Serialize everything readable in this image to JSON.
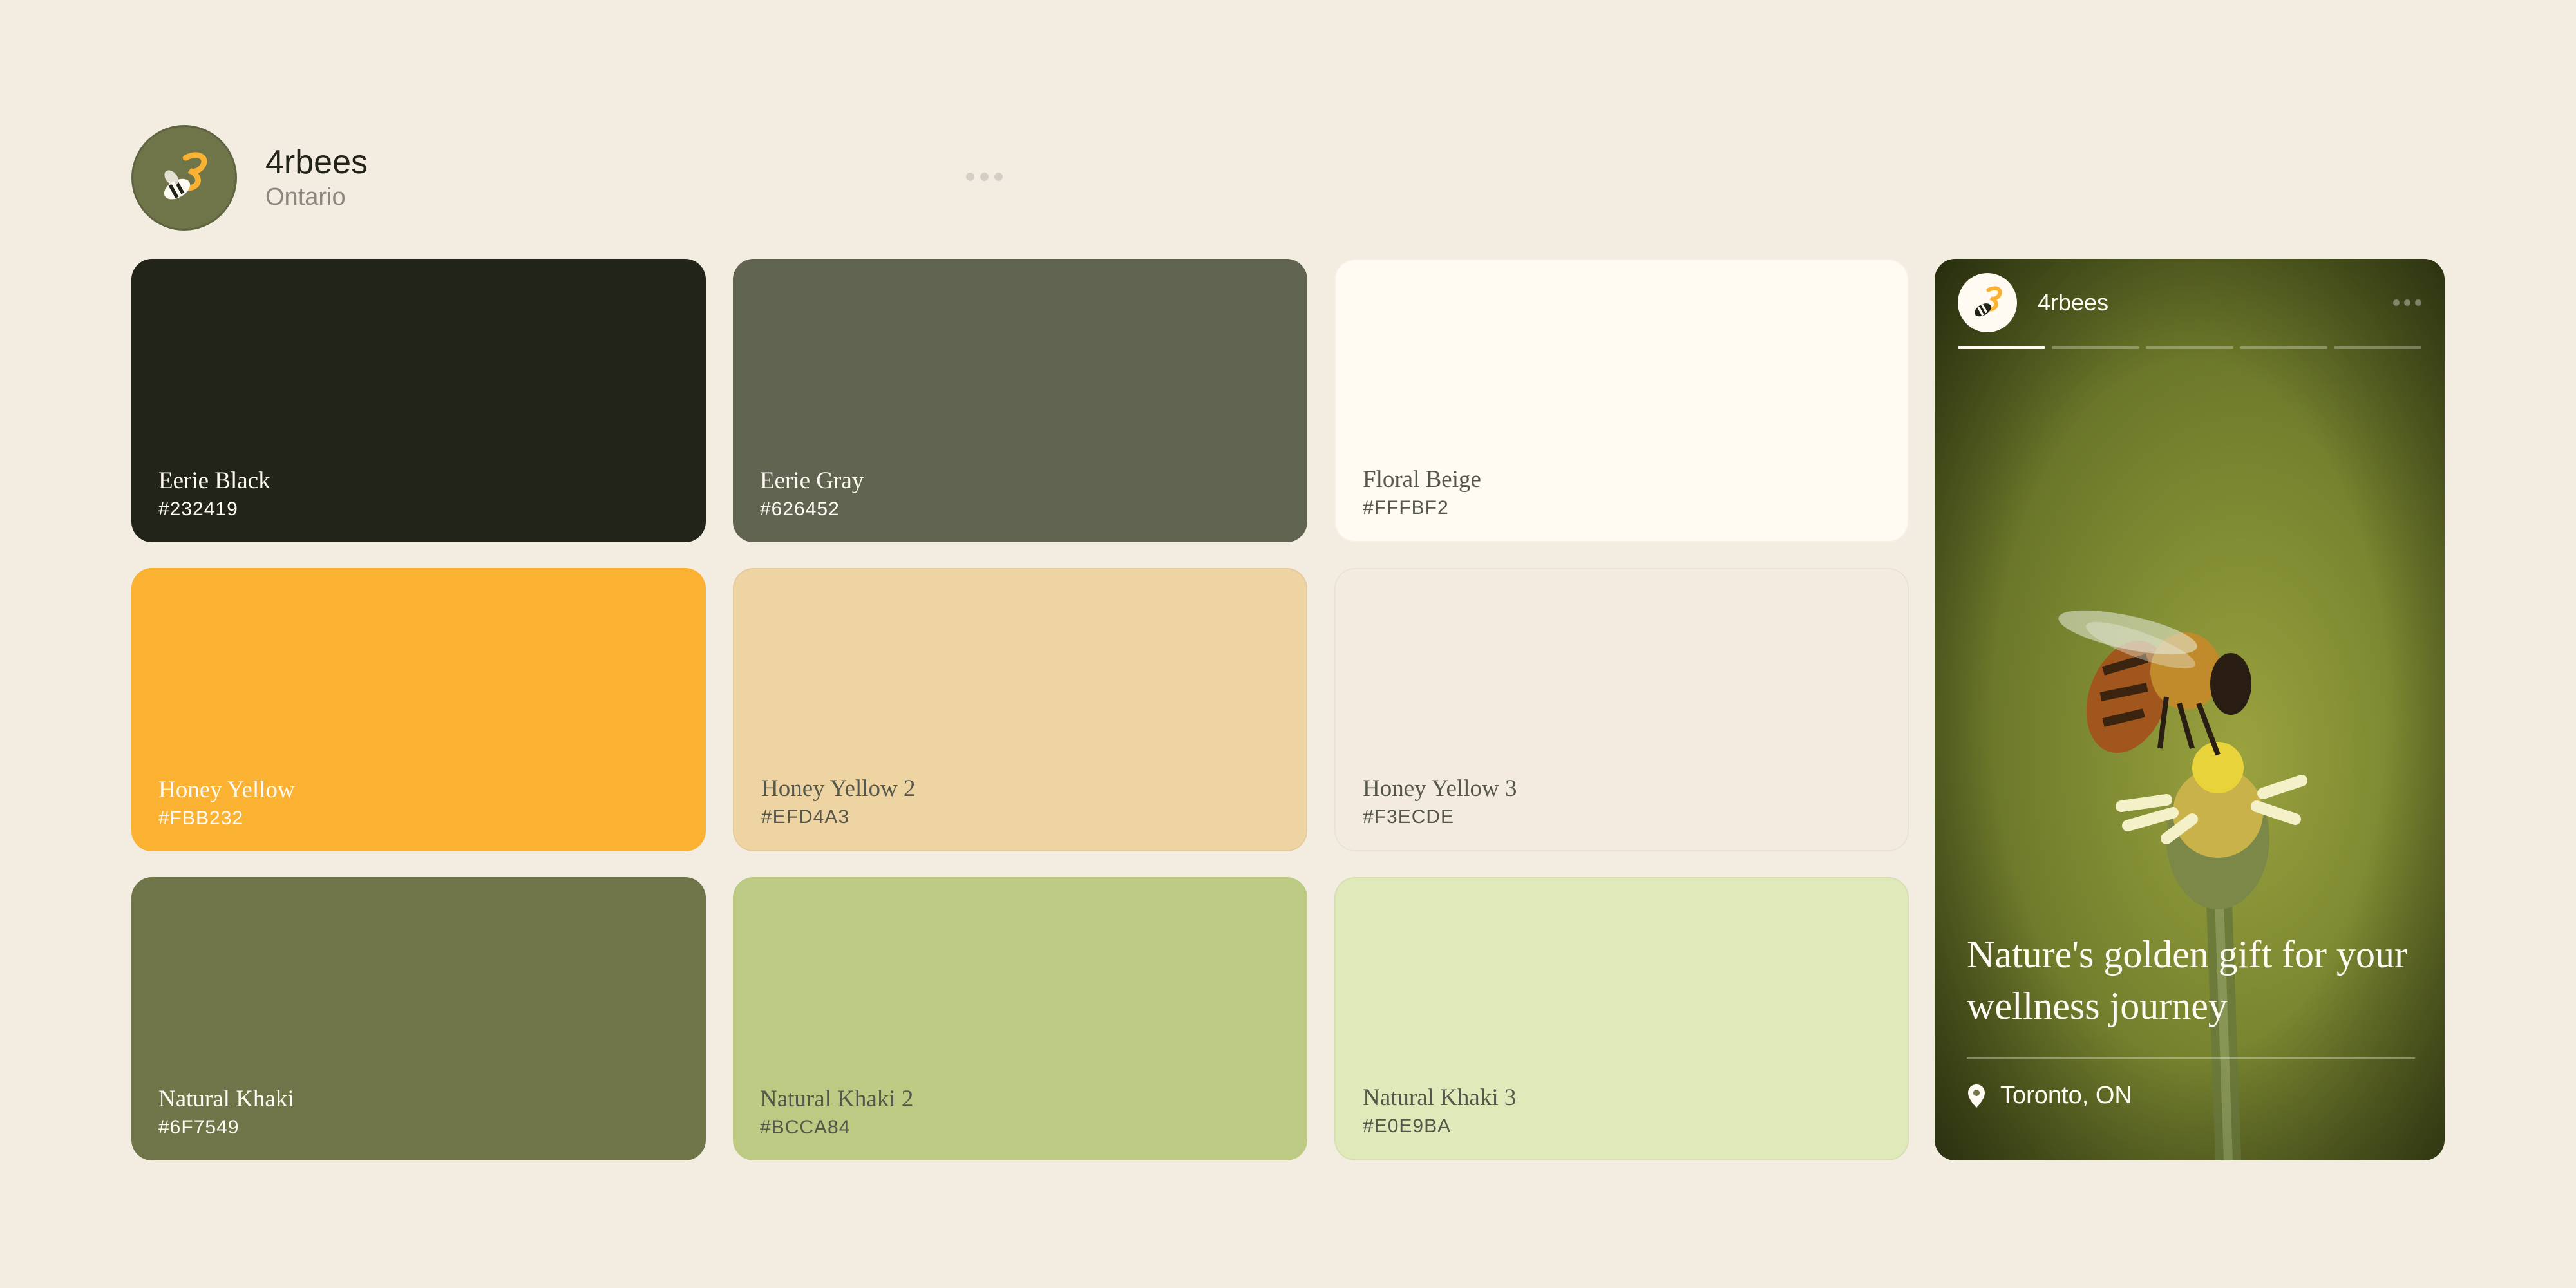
{
  "profile": {
    "name": "4rbees",
    "location": "Ontario"
  },
  "swatches": [
    {
      "name": "Eerie Black",
      "hex": "#232419",
      "color": "#232419",
      "text": "light"
    },
    {
      "name": "Eerie Gray",
      "hex": "#626452",
      "color": "#626452",
      "text": "light"
    },
    {
      "name": "Floral Beige",
      "hex": "#FFFBF2",
      "color": "#FFFBF2",
      "text": "dark"
    },
    {
      "name": "Honey Yellow",
      "hex": "#FBB232",
      "color": "#FBB232",
      "text": "light"
    },
    {
      "name": "Honey Yellow 2",
      "hex": "#EFD4A3",
      "color": "#EFD4A3",
      "text": "dark"
    },
    {
      "name": "Honey Yellow 3",
      "hex": "#F3ECDE",
      "color": "#F3ECDE",
      "text": "dark"
    },
    {
      "name": "Natural Khaki",
      "hex": "#6F7549",
      "color": "#6F7549",
      "text": "light"
    },
    {
      "name": "Natural Khaki 2",
      "hex": "#BCCA84",
      "color": "#BCCA84",
      "text": "dark"
    },
    {
      "name": "Natural Khaki 3",
      "hex": "#E0E9BA",
      "color": "#E0E9BA",
      "text": "dark"
    }
  ],
  "story": {
    "username": "4rbees",
    "title": "Nature's golden gift for your wellness journey",
    "location": "Toronto, ON",
    "segments": 5,
    "active_segment": 1
  }
}
